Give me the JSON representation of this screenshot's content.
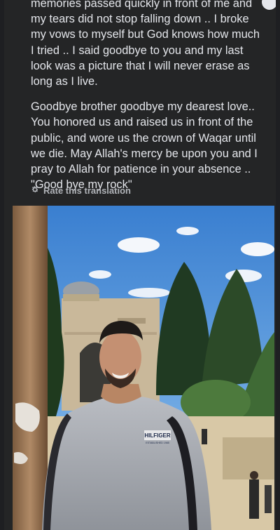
{
  "post": {
    "paragraph_1": "memories passed quickly in front of me and my tears did not stop falling down .. I broke my vows to myself but God knows how much I tried .. I said goodbye to you and my last look was a picture that I will never erase as long as I live.",
    "paragraph_2": "Goodbye brother goodbye my dearest love.. You honored us and raised us in front of the public, and wore us the crown of Waqar until we die. May Allah's mercy be upon you and I pray to Allah for patience in your absence .. \"Good bye my rock\""
  },
  "translation": {
    "rate_label": "Rate this translation",
    "icon": "gear-icon"
  },
  "photo": {
    "shirt_brand": "HILFIGER",
    "shirt_brand_sub": "ESTABLISHED 1985"
  },
  "colors": {
    "background": "#242526",
    "text": "#e4e6eb",
    "secondary_text": "#b0b3b8",
    "sky": "#4a8fd6"
  }
}
